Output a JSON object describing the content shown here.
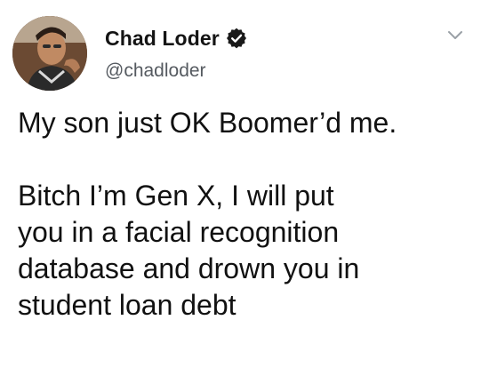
{
  "author": {
    "display_name": "Chad Loder",
    "handle": "@chadloder",
    "verified": true
  },
  "icons": {
    "avatar": "user-photo-avatar",
    "verified": "verified-badge-icon",
    "menu": "chevron-down-icon"
  },
  "colors": {
    "name": "#141414",
    "handle": "#555a60",
    "text": "#111111",
    "badge": "#1a1a1a"
  },
  "tweet": {
    "lines": [
      "My son just OK Boomer’d me.",
      "",
      "Bitch I’m Gen X, I will put",
      "you in a facial recognition",
      "database and drown you in",
      "student loan debt"
    ]
  }
}
